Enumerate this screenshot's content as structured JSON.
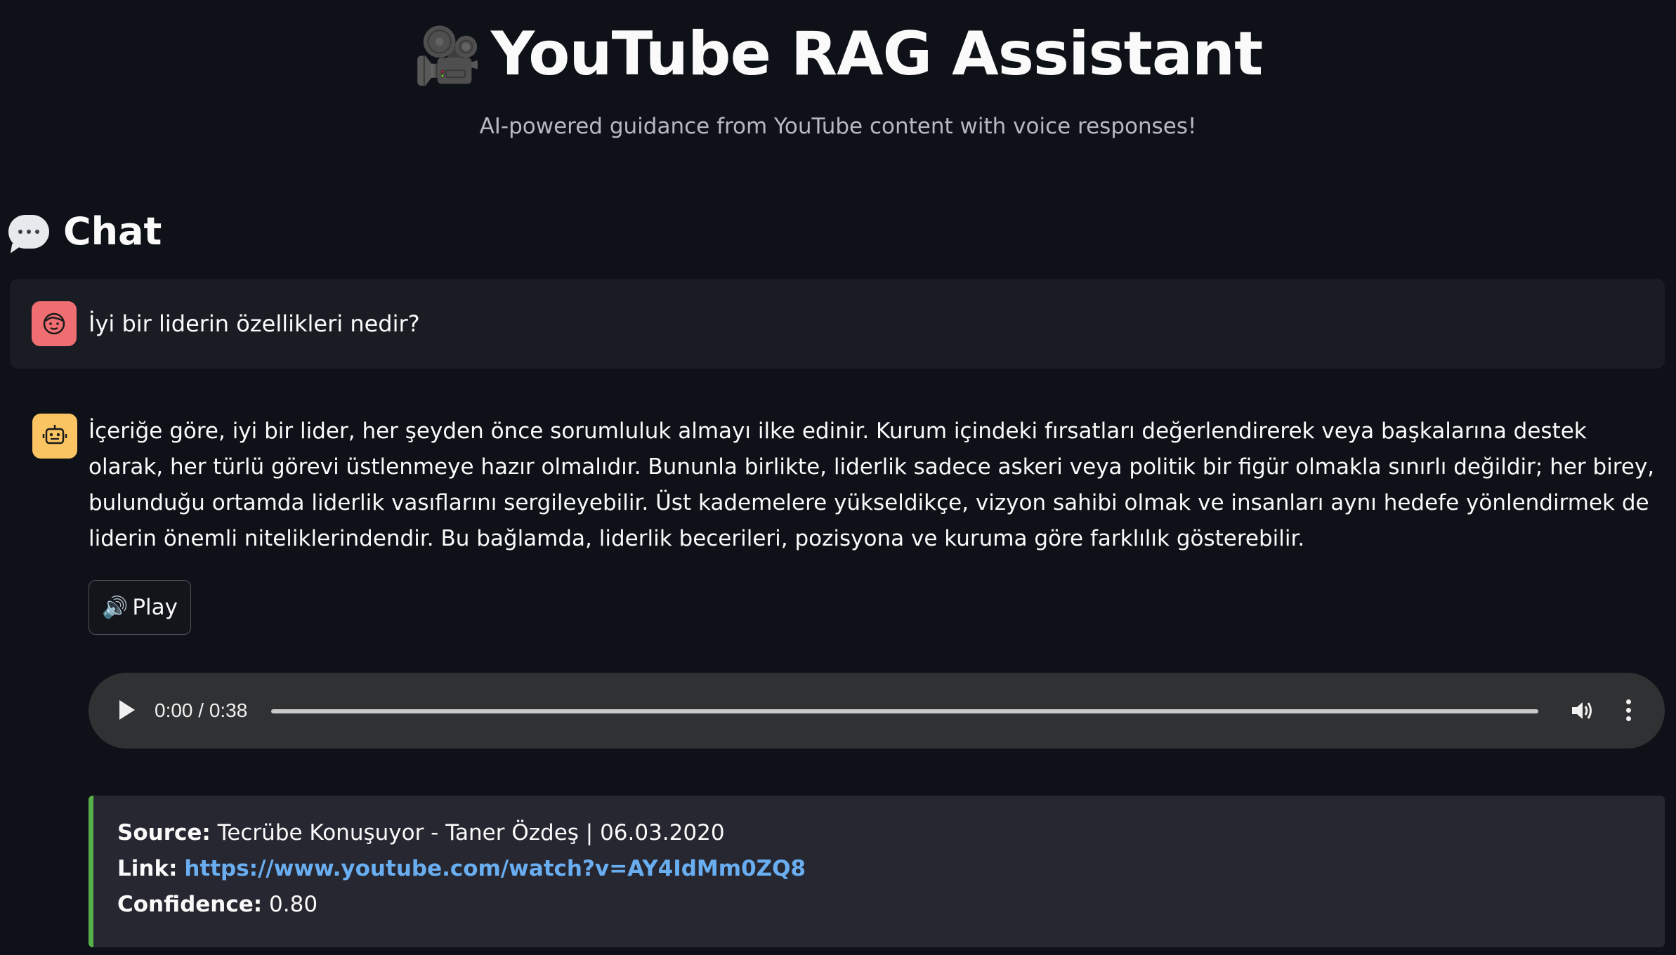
{
  "header": {
    "title_icon": "movie-camera-icon",
    "title": "YouTube RAG Assistant",
    "subtitle": "AI-powered guidance from YouTube content with voice responses!"
  },
  "chat": {
    "heading_icon": "speech-bubble-icon",
    "heading": "Chat",
    "user_message": {
      "avatar_icon": "user-face-icon",
      "avatar_color": "#ee6e72",
      "text": "İyi bir liderin özellikleri nedir?"
    },
    "assistant_message": {
      "avatar_icon": "robot-icon",
      "avatar_color": "#fbc462",
      "text": "İçeriğe göre, iyi bir lider, her şeyden önce sorumluluk almayı ilke edinir. Kurum içindeki fırsatları değerlendirerek veya başkalarına destek olarak, her türlü görevi üstlenmeye hazır olmalıdır. Bununla birlikte, liderlik sadece askeri veya politik bir figür olmakla sınırlı değildir; her birey, bulunduğu ortamda liderlik vasıflarını sergileyebilir. Üst kademelere yükseldikçe, vizyon sahibi olmak ve insanları aynı hedefe yönlendirmek de liderin önemli niteliklerindendir. Bu bağlamda, liderlik becerileri, pozisyona ve kuruma göre farklılık gösterebilir.",
      "play_button": {
        "icon": "speaker-icon",
        "label": "Play"
      },
      "audio": {
        "current_time": "0:00",
        "duration": "0:38",
        "time_display": "0:00 / 0:38",
        "progress": 0
      },
      "source": {
        "source_label": "Source:",
        "source_value": "Tecrübe Konuşuyor - Taner Özdeş | 06.03.2020",
        "link_label": "Link:",
        "link_value": "https://www.youtube.com/watch?v=AY4IdMm0ZQ8",
        "confidence_label": "Confidence:",
        "confidence_value": "0.80",
        "accent_color": "#58b04a"
      }
    }
  }
}
